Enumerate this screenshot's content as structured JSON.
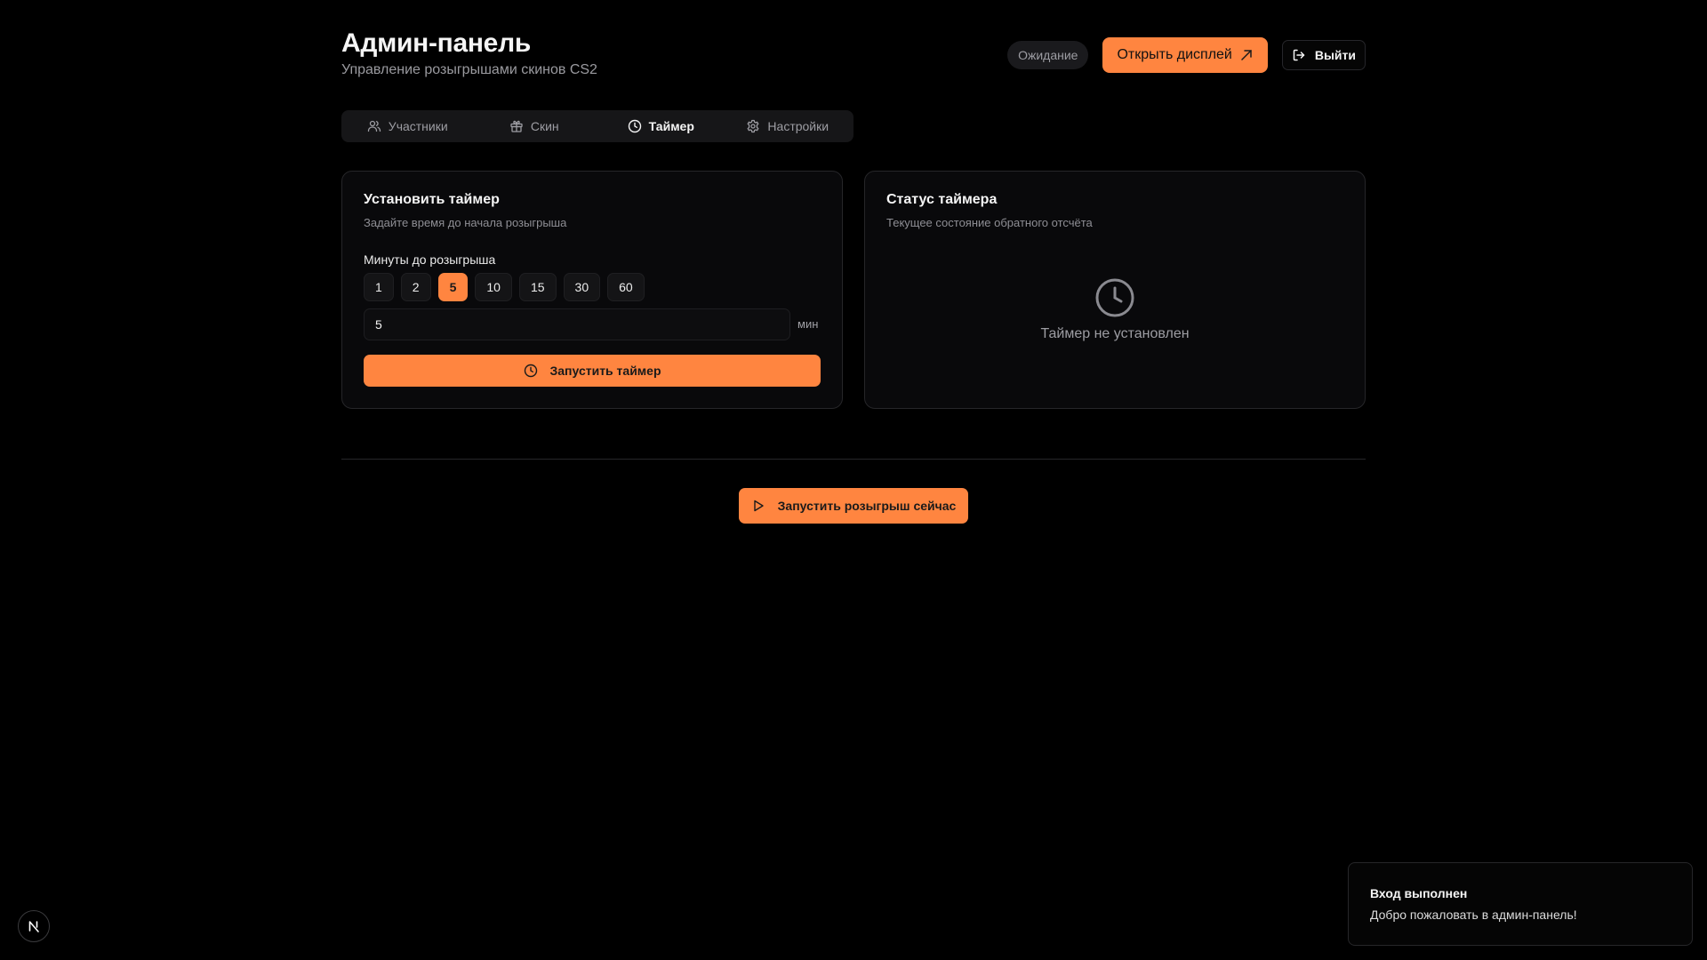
{
  "header": {
    "title": "Админ-панель",
    "subtitle": "Управление розыгрышами скинов CS2",
    "status_badge": "Ожидание",
    "open_display_label": "Открыть дисплей",
    "logout_label": "Выйти"
  },
  "tabs": [
    {
      "label": "Участники",
      "icon": "users-icon"
    },
    {
      "label": "Скин",
      "icon": "gift-icon"
    },
    {
      "label": "Таймер",
      "icon": "clock-icon",
      "active": true
    },
    {
      "label": "Настройки",
      "icon": "gear-icon"
    }
  ],
  "timer_setup": {
    "title": "Установить таймер",
    "description": "Задайте время до начала розыгрыша",
    "field_label": "Минуты до розыгрыша",
    "presets": [
      "1",
      "2",
      "5",
      "10",
      "15",
      "30",
      "60"
    ],
    "selected_preset": "5",
    "input_value": "5",
    "unit": "мин",
    "start_label": "Запустить таймер"
  },
  "timer_status": {
    "title": "Статус таймера",
    "description": "Текущее состояние обратного отсчёта",
    "empty_text": "Таймер не установлен"
  },
  "draw_now_label": "Запустить розыгрыш сейчас",
  "toast": {
    "title": "Вход выполнен",
    "message": "Добро пожаловать в админ-панель!"
  },
  "colors": {
    "accent": "#ff8540",
    "background": "#000000",
    "card": "#09090b",
    "border": "#262629",
    "muted_text": "#9d9da3"
  }
}
